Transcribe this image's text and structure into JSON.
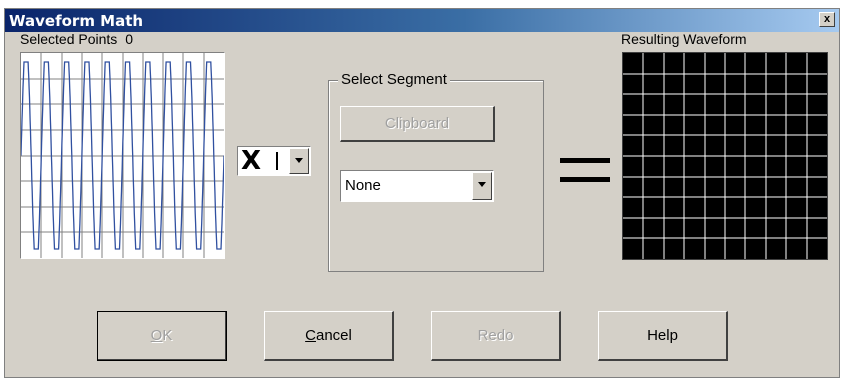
{
  "window": {
    "title": "Waveform Math",
    "close_glyph": "x"
  },
  "left_panel": {
    "label": "Selected Points",
    "count": "0",
    "plot": {
      "background": "#ffffff",
      "grid_color": "#808080",
      "trace_color": "#3050a0",
      "cycles": 10
    }
  },
  "operator": {
    "selected": "X",
    "icon": "chevron-down-icon"
  },
  "segment_group": {
    "title": "Select Segment",
    "clipboard_label": "Clipboard",
    "segment_value": "None"
  },
  "equals_sign": "=",
  "right_panel": {
    "label": "Resulting Waveform",
    "plot": {
      "background": "#000000",
      "grid_color": "#ffffff"
    }
  },
  "buttons": {
    "ok": {
      "mnemonic": "O",
      "rest": "K"
    },
    "cancel": {
      "mnemonic": "C",
      "rest": "ancel"
    },
    "redo": "Redo",
    "help": "Help"
  }
}
